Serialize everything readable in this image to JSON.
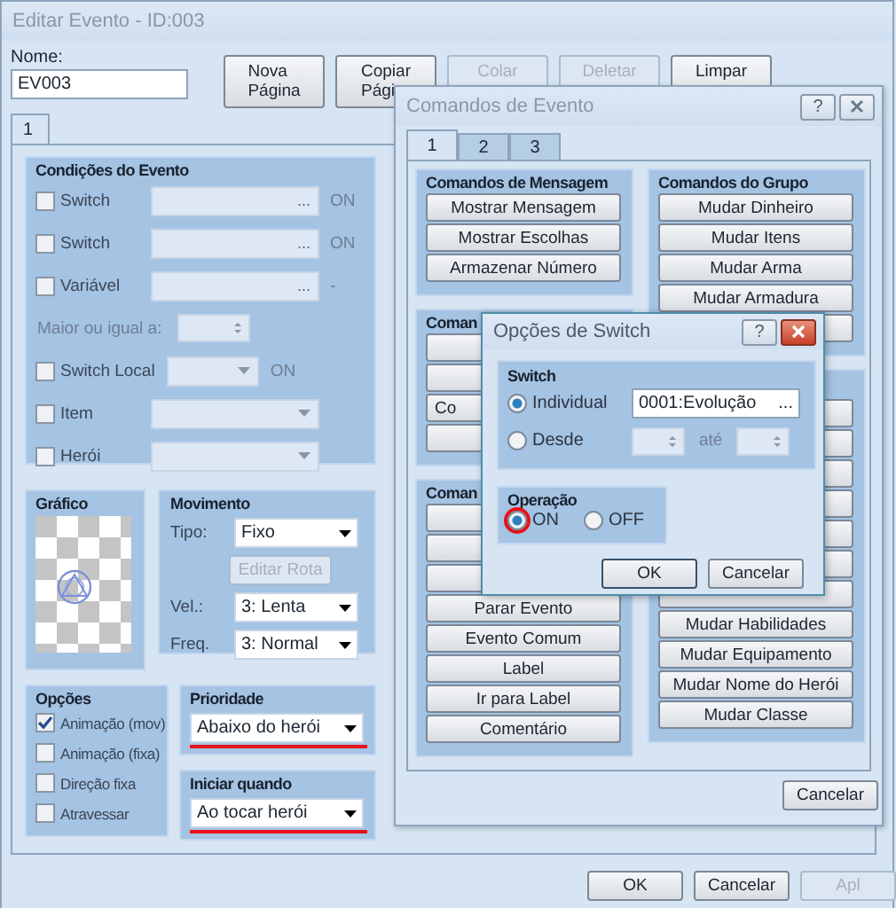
{
  "main_window": {
    "title": "Editar Evento - ID:003",
    "name_label": "Nome:",
    "name_value": "EV003",
    "page_buttons": [
      {
        "lines": [
          "Nova",
          "Página"
        ],
        "disabled": false
      },
      {
        "lines": [
          "Copiar",
          "Pági"
        ],
        "disabled": false
      },
      {
        "lines": [
          "Colar"
        ],
        "disabled": true
      },
      {
        "lines": [
          "Deletar"
        ],
        "disabled": true
      },
      {
        "lines": [
          "Limpar"
        ],
        "disabled": false
      }
    ],
    "tabs": [
      {
        "label": "1",
        "selected": true
      }
    ],
    "conditions": {
      "title": "Condições do Evento",
      "rows": [
        {
          "kind": "field",
          "label": "Switch",
          "checked": false,
          "ellipsis": "...",
          "suffix": "ON"
        },
        {
          "kind": "field",
          "label": "Switch",
          "checked": false,
          "ellipsis": "...",
          "suffix": "ON"
        },
        {
          "kind": "field",
          "label": "Variável",
          "checked": false,
          "ellipsis": "...",
          "suffix": "-"
        },
        {
          "kind": "spin",
          "label": "Maior ou igual a:"
        },
        {
          "kind": "dropdown",
          "label": "Switch Local",
          "checked": false,
          "suffix": "ON"
        },
        {
          "kind": "dropdown",
          "label": "Item",
          "checked": false
        },
        {
          "kind": "dropdown",
          "label": "Herói",
          "checked": false
        }
      ]
    },
    "graphic": {
      "title": "Gráfico"
    },
    "movement": {
      "title": "Movimento",
      "type_label": "Tipo:",
      "type_value": "Fixo",
      "route_button": "Editar Rota",
      "speed_label": "Vel.:",
      "speed_value": "3: Lenta",
      "freq_label": "Freq.",
      "freq_value": "3: Normal"
    },
    "options": {
      "title": "Opções",
      "items": [
        {
          "label": "Animação (mov)",
          "checked": true
        },
        {
          "label": "Animação (fixa)",
          "checked": false
        },
        {
          "label": "Direção fixa",
          "checked": false
        },
        {
          "label": "Atravessar",
          "checked": false
        }
      ]
    },
    "priority": {
      "title": "Prioridade",
      "value": "Abaixo do herói",
      "highlighted": true
    },
    "trigger": {
      "title": "Iniciar quando",
      "value": "Ao tocar herói",
      "highlighted": true
    },
    "footer_buttons": [
      {
        "label": "OK",
        "disabled": false
      },
      {
        "label": "Cancelar",
        "disabled": false
      },
      {
        "label": "Apl",
        "disabled": true
      }
    ]
  },
  "commands_window": {
    "title": "Comandos de Evento",
    "help": "?",
    "tabs": [
      {
        "label": "1",
        "selected": true
      },
      {
        "label": "2",
        "selected": false
      },
      {
        "label": "3",
        "selected": false
      }
    ],
    "left_groups": [
      {
        "title": "Comandos de Mensagem",
        "buttons": [
          {
            "kind": "command",
            "label": "Mostrar Mensagem"
          },
          {
            "kind": "command",
            "label": "Mostrar Escolhas"
          },
          {
            "kind": "command",
            "label": "Armazenar Número"
          }
        ]
      },
      {
        "title": "Coman",
        "buttons": [
          {
            "kind": "blank"
          },
          {
            "kind": "blank"
          },
          {
            "kind": "partial",
            "label": "Co"
          },
          {
            "kind": "blank"
          }
        ]
      },
      {
        "title": "Coman",
        "buttons": [
          {
            "kind": "blank"
          },
          {
            "kind": "blank"
          },
          {
            "kind": "blank"
          },
          {
            "kind": "command",
            "label": "Parar Evento"
          },
          {
            "kind": "command",
            "label": "Evento Comum"
          },
          {
            "kind": "command",
            "label": "Label"
          },
          {
            "kind": "command",
            "label": "Ir para Label"
          },
          {
            "kind": "command",
            "label": "Comentário"
          }
        ]
      }
    ],
    "right_groups": [
      {
        "title": "Comandos do Grupo",
        "buttons": [
          {
            "kind": "command",
            "label": "Mudar Dinheiro"
          },
          {
            "kind": "command",
            "label": "Mudar Itens"
          },
          {
            "kind": "command",
            "label": "Mudar Arma"
          },
          {
            "kind": "command",
            "label": "Mudar Armadura"
          },
          {
            "kind": "blank"
          }
        ]
      },
      {
        "buttons": [
          {
            "kind": "blank"
          },
          {
            "kind": "blank"
          },
          {
            "kind": "blank"
          },
          {
            "kind": "blank"
          },
          {
            "kind": "blank"
          },
          {
            "kind": "blank"
          },
          {
            "kind": "blank"
          },
          {
            "kind": "command",
            "label": "Mudar Habilidades"
          },
          {
            "kind": "command",
            "label": "Mudar Equipamento"
          },
          {
            "kind": "command",
            "label": "Mudar Nome do Herói"
          },
          {
            "kind": "command",
            "label": "Mudar Classe"
          }
        ]
      }
    ],
    "cancel_button": "Cancelar"
  },
  "switch_dialog": {
    "title": "Opções de Switch",
    "help": "?",
    "group_title": "Switch",
    "modes": [
      {
        "label": "Individual",
        "selected": true
      },
      {
        "label": "Desde",
        "selected": false
      }
    ],
    "switch_value": "0001:Evolução",
    "ellipsis": "...",
    "range_label": "até",
    "operation_title": "Operação",
    "operations": [
      {
        "label": "ON",
        "selected": true,
        "highlighted": true
      },
      {
        "label": "OFF",
        "selected": false,
        "highlighted": false
      }
    ],
    "buttons": [
      {
        "label": "OK",
        "default": true
      },
      {
        "label": "Cancelar",
        "default": false
      }
    ]
  }
}
